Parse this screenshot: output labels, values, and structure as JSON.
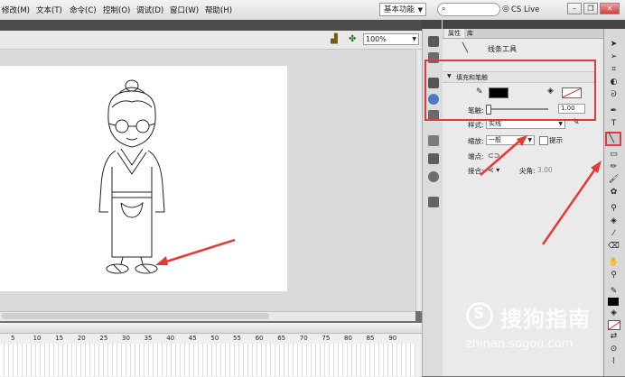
{
  "menubar": {
    "items": [
      "修改(M)",
      "文本(T)",
      "命令(C)",
      "控制(O)",
      "调试(D)",
      "窗口(W)",
      "帮助(H)"
    ],
    "workspace": "基本功能",
    "cslive": "CS Live"
  },
  "stage": {
    "zoom": "100%"
  },
  "timeline": {
    "frame_numbers": [
      "5",
      "10",
      "15",
      "20",
      "25",
      "30",
      "35",
      "40",
      "45",
      "50",
      "55",
      "60",
      "65",
      "70",
      "75",
      "80",
      "85",
      "90"
    ]
  },
  "properties": {
    "tabs": [
      "属性",
      "库"
    ],
    "tool_name": "线条工具",
    "section_fill_stroke": "填充和笔触",
    "stroke_label": "笔触:",
    "stroke_value": "1.00",
    "style_label": "样式:",
    "style_value": "实线",
    "scale_label": "缩放:",
    "scale_value": "一般",
    "hint_label": "提示",
    "cap_label": "端点:",
    "join_label": "接合:",
    "miter_label": "尖角:",
    "miter_value": "3.00",
    "stroke_color": "#000000"
  },
  "watermark": {
    "brand": "搜狗指南",
    "url": "zhinan.sogou.com"
  }
}
